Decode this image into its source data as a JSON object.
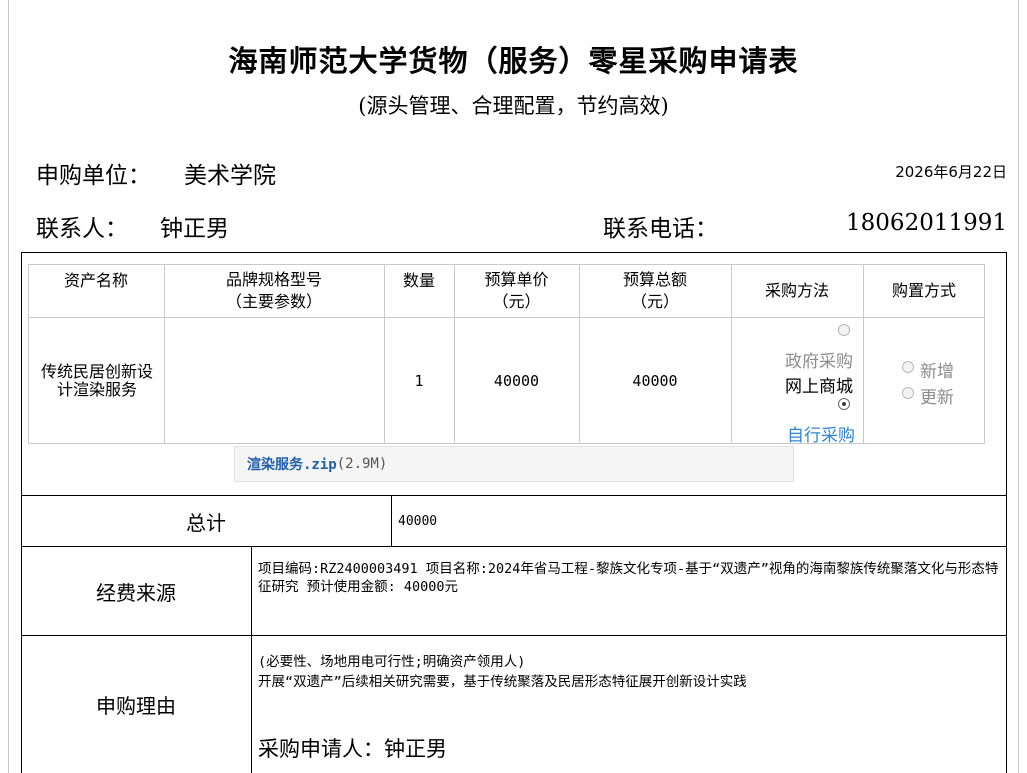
{
  "form": {
    "title": "海南师范大学货物（服务）零星采购申请表",
    "subtitle": "(源头管理、合理配置，节约高效)",
    "unit_label": "申购单位：",
    "unit_value": "美术学院",
    "date": "2026年6月22日",
    "contact_label": "联系人：",
    "contact_value": "钟正男",
    "phone_label": "联系电话：",
    "phone_value": "18062011991"
  },
  "table": {
    "headers": {
      "asset_name": "资产名称",
      "spec_line1": "品牌规格型号",
      "spec_line2": "（主要参数）",
      "quantity": "数量",
      "unit_price_line1": "预算单价",
      "unit_price_line2": "（元）",
      "total_line1": "预算总额",
      "total_line2": "（元）",
      "method": "采购方法",
      "purchase_type": "购置方式"
    },
    "row": {
      "asset_name": "传统民居创新设计渲染服务",
      "spec": "",
      "quantity": "1",
      "unit_price": "40000",
      "total": "40000"
    },
    "methods": [
      {
        "label": "政府采购",
        "selected": false
      },
      {
        "label": "网上商城",
        "selected": false
      },
      {
        "label": "自行采购",
        "selected": true
      }
    ],
    "purchase_types": [
      {
        "label": "新增",
        "selected": false
      },
      {
        "label": "更新",
        "selected": false
      }
    ]
  },
  "attachment": {
    "name": "渲染服务.zip",
    "size": "(2.9M)"
  },
  "total": {
    "label": "总计",
    "value": "40000"
  },
  "funding": {
    "label": "经费来源",
    "text": " 项目编码:RZ2400003491 项目名称:2024年省马工程-黎族文化专项-基于“双遗产”视角的海南黎族传统聚落文化与形态特征研究 预计使用金额: 40000元"
  },
  "reason": {
    "label": "申购理由",
    "hint": "(必要性、场地用电可行性;明确资产领用人)",
    "text": "开展“双遗产”后续相关研究需要，基于传统聚落及民居形态特征展开创新设计实践",
    "applicant_label": "采购申请人：",
    "applicant_name": "钟正男"
  }
}
